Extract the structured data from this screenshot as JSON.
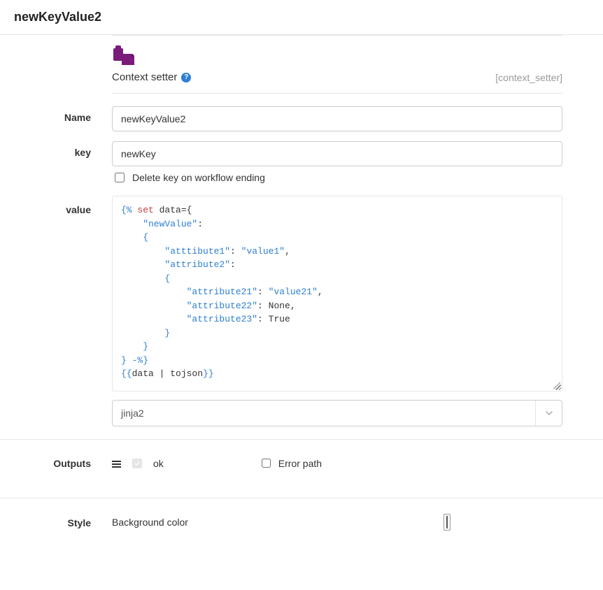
{
  "header": {
    "title": "newKeyValue2"
  },
  "node": {
    "type_label": "Context setter",
    "id_label": "[context_setter]"
  },
  "form": {
    "name": {
      "label": "Name",
      "value": "newKeyValue2"
    },
    "key": {
      "label": "key",
      "value": "newKey"
    },
    "delete_key": {
      "label": "Delete key on workflow ending",
      "checked": false
    },
    "value": {
      "label": "value",
      "code": {
        "tokens": [
          {
            "t": "{% ",
            "c": "tok-punc"
          },
          {
            "t": "set",
            "c": "tok-kw"
          },
          {
            "t": " data={\n",
            "c": "tok-var"
          },
          {
            "t": "    \"newValue\"",
            "c": "tok-str"
          },
          {
            "t": ":\n",
            "c": "tok-var"
          },
          {
            "t": "    {\n",
            "c": "tok-punc"
          },
          {
            "t": "        \"atttibute1\"",
            "c": "tok-str"
          },
          {
            "t": ": ",
            "c": "tok-var"
          },
          {
            "t": "\"value1\"",
            "c": "tok-str"
          },
          {
            "t": ",\n",
            "c": "tok-var"
          },
          {
            "t": "        \"attribute2\"",
            "c": "tok-str"
          },
          {
            "t": ":\n",
            "c": "tok-var"
          },
          {
            "t": "        {\n",
            "c": "tok-punc"
          },
          {
            "t": "            \"attribute21\"",
            "c": "tok-str"
          },
          {
            "t": ": ",
            "c": "tok-var"
          },
          {
            "t": "\"value21\"",
            "c": "tok-str"
          },
          {
            "t": ",\n",
            "c": "tok-var"
          },
          {
            "t": "            \"attribute22\"",
            "c": "tok-str"
          },
          {
            "t": ": ",
            "c": "tok-var"
          },
          {
            "t": "None",
            "c": "tok-none"
          },
          {
            "t": ",\n",
            "c": "tok-var"
          },
          {
            "t": "            \"attribute23\"",
            "c": "tok-str"
          },
          {
            "t": ": ",
            "c": "tok-var"
          },
          {
            "t": "True",
            "c": "tok-true"
          },
          {
            "t": "\n",
            "c": "tok-var"
          },
          {
            "t": "        }\n",
            "c": "tok-punc"
          },
          {
            "t": "    }\n",
            "c": "tok-punc"
          },
          {
            "t": "} -%}",
            "c": "tok-punc"
          },
          {
            "t": "\n",
            "c": "tok-var"
          },
          {
            "t": "{{",
            "c": "tok-punc"
          },
          {
            "t": "data | tojson",
            "c": "tok-var"
          },
          {
            "t": "}}",
            "c": "tok-punc"
          }
        ]
      },
      "template_engine": "jinja2"
    }
  },
  "outputs": {
    "label": "Outputs",
    "ok_label": "ok",
    "error_path_label": "Error path",
    "error_path_checked": false
  },
  "style": {
    "label": "Style",
    "bg_label": "Background color",
    "bg_color": "#a3c9ef"
  }
}
